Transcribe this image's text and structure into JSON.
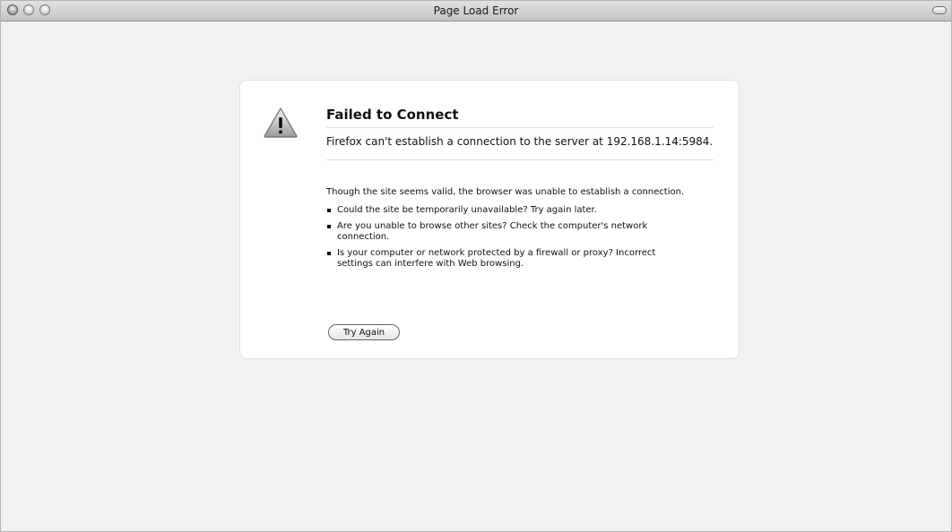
{
  "window": {
    "title": "Page Load Error"
  },
  "error": {
    "title": "Failed to Connect",
    "short_desc": "Firefox can't establish a connection to the server at 192.168.1.14:5984.",
    "long_intro": "Though the site seems valid, the browser was unable to establish a connection.",
    "bullets": [
      "Could the site be temporarily unavailable? Try again later.",
      "Are you unable to browse other sites? Check the computer's network connection.",
      "Is your computer or network protected by a firewall or proxy? Incorrect settings can interfere with Web browsing."
    ],
    "try_again_label": "Try Again",
    "icon": "warning-triangle-icon"
  },
  "colors": {
    "titlebar": "#c8c8c8",
    "background": "#f1f1f1",
    "box": "#ffffff"
  }
}
